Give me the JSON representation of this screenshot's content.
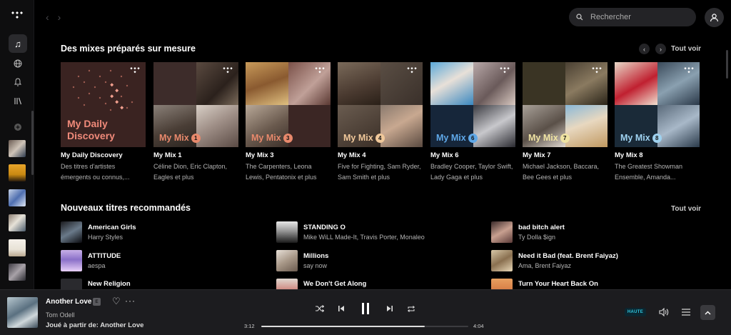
{
  "search": {
    "placeholder": "Rechercher"
  },
  "mixes": {
    "title": "Des mixes préparés sur mesure",
    "see_all": "Tout voir",
    "daily_label_line1": "My Daily",
    "daily_label_line2": "Discovery",
    "cards": [
      {
        "title": "My Daily Discovery",
        "desc": "Des titres d'artistes émergents ou connus,...",
        "label": "",
        "num": ""
      },
      {
        "title": "My Mix 1",
        "desc": "Céline Dion, Eric Clapton, Eagles et plus",
        "label": "My Mix",
        "num": "1",
        "accent": "#e8896c"
      },
      {
        "title": "My Mix 3",
        "desc": "The Carpenters, Leona Lewis, Pentatonix et plus",
        "label": "My Mix",
        "num": "3",
        "accent": "#e8896c"
      },
      {
        "title": "My Mix 4",
        "desc": "Five for Fighting, Sam Ryder, Sam Smith et plus",
        "label": "My Mix",
        "num": "4",
        "accent": "#f0c89a"
      },
      {
        "title": "My Mix 6",
        "desc": "Bradley Cooper, Taylor Swift, Lady Gaga et plus",
        "label": "My Mix",
        "num": "6",
        "accent": "#5fa8e8"
      },
      {
        "title": "My Mix 7",
        "desc": "Michael Jackson, Baccara, Bee Gees et plus",
        "label": "My Mix",
        "num": "7",
        "accent": "#efe3a2"
      },
      {
        "title": "My Mix 8",
        "desc": "The Greatest Showman Ensemble, Amanda...",
        "label": "My Mix",
        "num": "8",
        "accent": "#9fd2f0"
      }
    ]
  },
  "new_tracks": {
    "title": "Nouveaux titres recommandés",
    "see_all": "Tout voir",
    "items": [
      {
        "title": "American Girls",
        "artist": "Harry Styles"
      },
      {
        "title": "ATTITUDE",
        "artist": "aespa"
      },
      {
        "title": "New Religion",
        "artist": ""
      },
      {
        "title": "STANDING O",
        "artist": "Mike WiLL Made-It, Travis Porter, Monaleo"
      },
      {
        "title": "Millions",
        "artist": "say now"
      },
      {
        "title": "We Don't Get Along",
        "artist": ""
      },
      {
        "title": "bad bitch alert",
        "artist": "Ty Dolla $ign"
      },
      {
        "title": "Need it Bad (feat. Brent Faiyaz)",
        "artist": "Ama, Brent Faiyaz"
      },
      {
        "title": "Turn Your Heart Back On",
        "artist": ""
      }
    ]
  },
  "player": {
    "title": "Another Love",
    "badge": "E",
    "artist": "Tom Odell",
    "context": "Joué à partir de: Another Love",
    "current_time": "3:12",
    "total_time": "4:04",
    "progress": 0.79,
    "quality": "HAUTE"
  },
  "icons": {
    "logo": "tidal-logo-icon",
    "music": "music-note-icon",
    "explore": "globe-icon",
    "notifications": "bell-icon",
    "collection": "library-icon",
    "add": "plus-circle-icon"
  }
}
